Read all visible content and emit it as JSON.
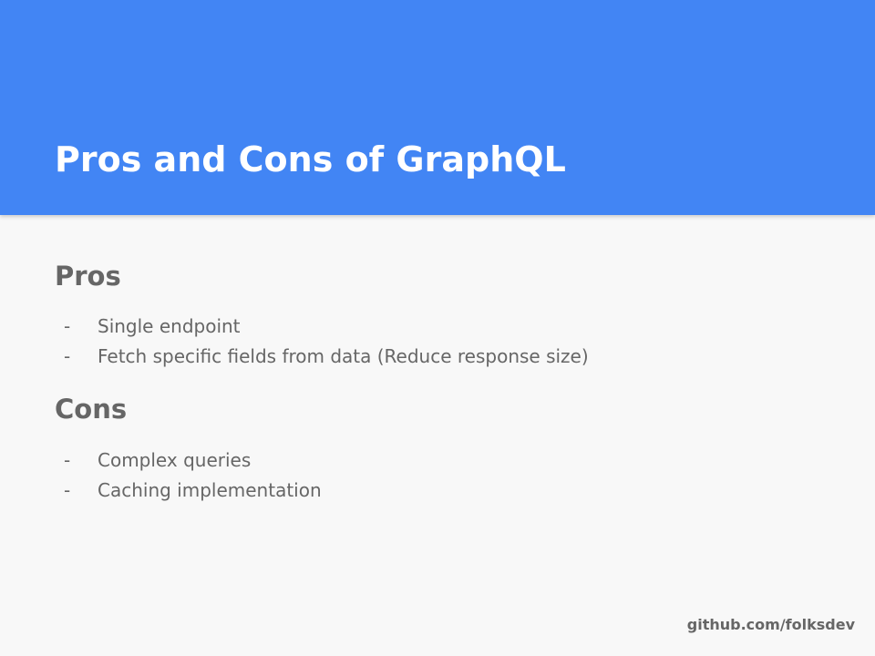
{
  "slide": {
    "title": "Pros and Cons of GraphQL",
    "accent_color": "#4285f4",
    "footer": "github.com/folksdev"
  },
  "sections": [
    {
      "heading": "Pros",
      "bullet_symbol": "-",
      "items": [
        "Single endpoint",
        "Fetch specific fields from data (Reduce response size)"
      ]
    },
    {
      "heading": "Cons",
      "bullet_symbol": "-",
      "items": [
        "Complex queries",
        "Caching implementation"
      ]
    }
  ]
}
